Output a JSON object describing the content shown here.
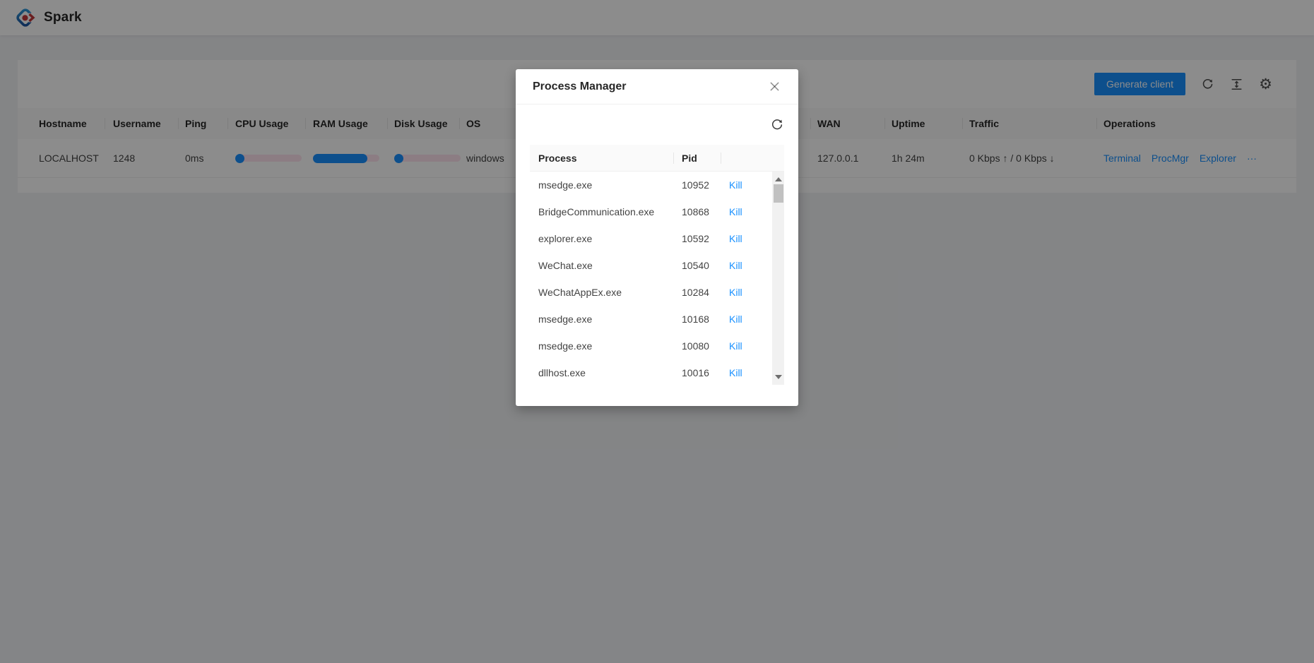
{
  "app": {
    "title": "Spark"
  },
  "toolbar": {
    "generate_label": "Generate client",
    "icons": {
      "reload": "reload-icon",
      "density": "column-height-icon",
      "settings_glyph": "⚙"
    }
  },
  "host_table": {
    "columns": [
      "Hostname",
      "Username",
      "Ping",
      "CPU Usage",
      "RAM Usage",
      "Disk Usage",
      "OS",
      "WAN",
      "Uptime",
      "Traffic",
      "Operations"
    ],
    "row": {
      "hostname": "LOCALHOST",
      "username": "1248",
      "ping": "0ms",
      "cpu_percent": 9,
      "ram_percent": 82,
      "disk_percent": 13,
      "os": "windows",
      "wan": "127.0.0.1",
      "uptime": "1h 24m",
      "traffic": "0 Kbps ↑ / 0 Kbps ↓",
      "operations": [
        "Terminal",
        "ProcMgr",
        "Explorer",
        "···"
      ]
    }
  },
  "modal": {
    "title": "Process Manager",
    "table": {
      "columns": {
        "process": "Process",
        "pid": "Pid"
      },
      "kill_label": "Kill",
      "rows": [
        {
          "process": "msedge.exe",
          "pid": "10952"
        },
        {
          "process": "BridgeCommunication.exe",
          "pid": "10868"
        },
        {
          "process": "explorer.exe",
          "pid": "10592"
        },
        {
          "process": "WeChat.exe",
          "pid": "10540"
        },
        {
          "process": "WeChatAppEx.exe",
          "pid": "10284"
        },
        {
          "process": "msedge.exe",
          "pid": "10168"
        },
        {
          "process": "msedge.exe",
          "pid": "10080"
        },
        {
          "process": "dllhost.exe",
          "pid": "10016"
        }
      ]
    }
  },
  "colors": {
    "primary": "#1890ff",
    "progress_trail": "#ffe3ef",
    "mask": "rgba(0,0,0,0.45)"
  }
}
